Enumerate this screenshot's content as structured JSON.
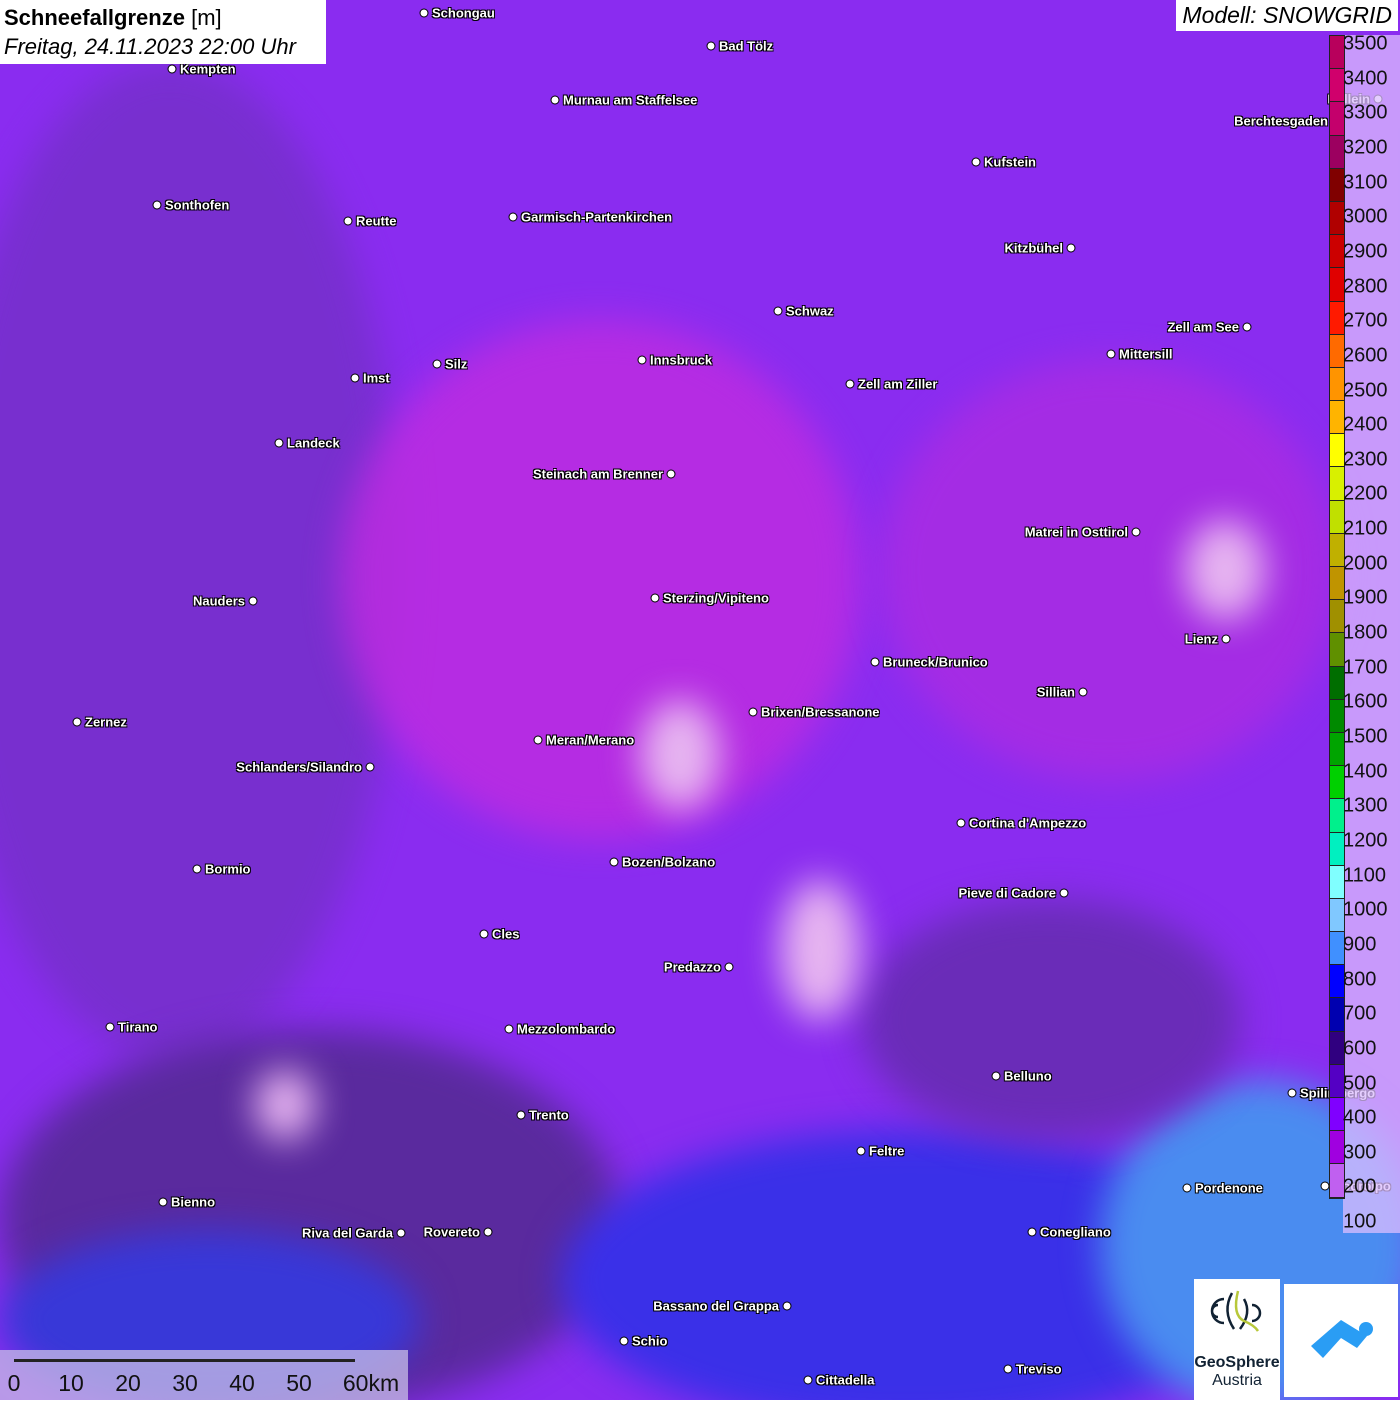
{
  "title": {
    "main": "Schneefallgrenze",
    "unit": "[m]",
    "datetime": "Freitag, 24.11.2023 22:00 Uhr"
  },
  "model": "Modell: SNOWGRID",
  "legend": {
    "labels": [
      "3500",
      "3400",
      "3300",
      "3200",
      "3100",
      "3000",
      "2900",
      "2800",
      "2700",
      "2600",
      "2500",
      "2400",
      "2300",
      "2200",
      "2100",
      "2000",
      "1900",
      "1800",
      "1700",
      "1600",
      "1500",
      "1400",
      "1300",
      "1200",
      "1100",
      "1000",
      "900",
      "800",
      "700",
      "600",
      "500",
      "400",
      "300",
      "200",
      "100"
    ],
    "colors": [
      "#b8005c",
      "#d0006c",
      "#c4006c",
      "#9c0060",
      "#800000",
      "#b00000",
      "#cc0000",
      "#e00000",
      "#ff1a00",
      "#ff6a00",
      "#ff9400",
      "#ffb400",
      "#ffff00",
      "#d8f000",
      "#c0e000",
      "#c0b000",
      "#c09400",
      "#a09000",
      "#609000",
      "#006e00",
      "#008a00",
      "#00a400",
      "#00d000",
      "#00f08c",
      "#00f0c0",
      "#80ffff",
      "#80c8ff",
      "#4090ff",
      "#0000ff",
      "#0000b0",
      "#300080",
      "#5400c4",
      "#8000ff",
      "#a000e0",
      "#c060f0"
    ]
  },
  "cities": [
    "Schongau",
    "Bad Tölz",
    "Kempten",
    "Murnau am Staffelsee",
    "Berchtesgaden",
    "Hallein",
    "Kufstein",
    "Sonthofen",
    "Reutte",
    "Garmisch-Partenkirchen",
    "Kitzbühel",
    "Schwaz",
    "Zell am See",
    "Innsbruck",
    "Mittersill",
    "Silz",
    "Imst",
    "Zell am Ziller",
    "Landeck",
    "Steinach am Brenner",
    "Matrei in Osttirol",
    "Nauders",
    "Sterzing/Vipiteno",
    "Lienz",
    "Bruneck/Brunico",
    "Sillian",
    "Brixen/Bressanone",
    "Zernez",
    "Meran/Merano",
    "Schlanders/Silandro",
    "Cortina d'Ampezzo",
    "Bozen/Bolzano",
    "Bormio",
    "Pieve di Cadore",
    "Cles",
    "Predazzo",
    "Tirano",
    "Mezzolombardo",
    "Belluno",
    "Spilimbergo",
    "Trento",
    "Feltre",
    "Pordenone",
    "Codroipo",
    "Bienno",
    "Riva del Garda",
    "Rovereto",
    "Conegliano",
    "Bassano del Grappa",
    "Schio",
    "Treviso",
    "Cittadella"
  ],
  "scale": [
    "0",
    "10",
    "20",
    "30",
    "40",
    "50",
    "60km"
  ],
  "logos": {
    "geosphere": [
      "GeoSphere",
      "Austria"
    ]
  }
}
